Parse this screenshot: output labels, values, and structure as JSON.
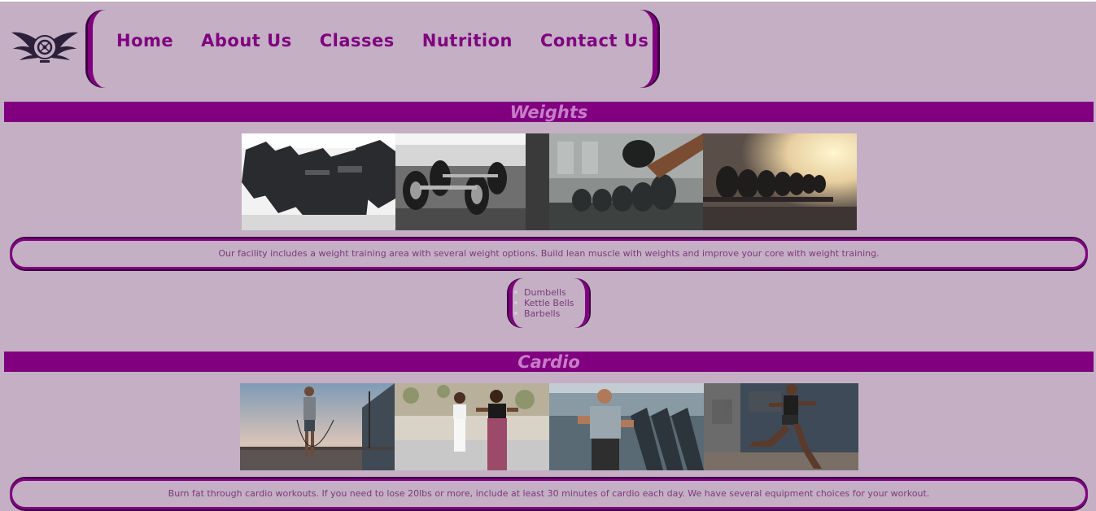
{
  "nav": {
    "items": [
      {
        "label": "Home"
      },
      {
        "label": "About Us"
      },
      {
        "label": "Classes"
      },
      {
        "label": "Nutrition"
      },
      {
        "label": "Contact Us"
      }
    ]
  },
  "weights": {
    "heading": "Weights",
    "photos": [
      "hex-dumbbell-rack-photo",
      "dumbbell-pair-photo",
      "dumbbell-lift-photo",
      "dumbbell-rack-sunlight-photo"
    ],
    "description": "Our facility includes a weight training area with several weight options. Build lean muscle with weights and improve your core with weight training.",
    "equipment": [
      "Dumbells",
      "Kettle Bells",
      "Barbells"
    ]
  },
  "cardio": {
    "heading": "Cardio",
    "photos": [
      "jump-rope-photo",
      "running-women-photo",
      "treadmill-photo",
      "sprinter-photo"
    ],
    "description": "Burn fat through cardio workouts. If you need to lose 20lbs or more, include at least 30 minutes of cardio each day. We have several equipment choices for your workout."
  },
  "colors": {
    "background": "#c4afc4",
    "accent": "#800080",
    "heading_text": "#c77dc7",
    "body_text": "#7a3a7a"
  }
}
